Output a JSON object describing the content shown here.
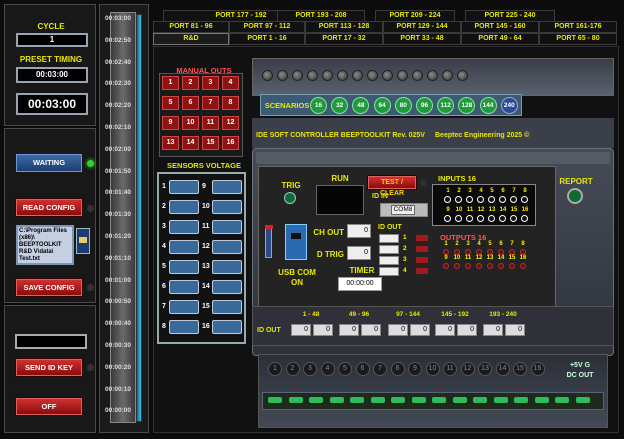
{
  "cycle": {
    "label": "CYCLE",
    "value": "1"
  },
  "preset": {
    "label": "PRESET TIMING",
    "value": "00:03:00",
    "display": "00:03:00"
  },
  "status": {
    "waiting": "WAITING"
  },
  "config": {
    "read": "READ CONFIG",
    "save": "SAVE CONFIG",
    "path": "C:\\Program Files (x86)\\ BEEPTOOLKIT R&D V\\data\\ Test.txt"
  },
  "idkey": {
    "send": "SEND ID KEY",
    "off": "OFF"
  },
  "timeline": [
    "00:03:00",
    "00:02:50",
    "00:02:40",
    "00:02:30",
    "00:02:20",
    "00:02:10",
    "00:02:00",
    "00:01:50",
    "00:01:40",
    "00:01:30",
    "00:01:20",
    "00:01:10",
    "00:01:00",
    "00:00:50",
    "00:00:40",
    "00:00:30",
    "00:00:20",
    "00:00:10",
    "00:00:00"
  ],
  "tabs": {
    "row1": [
      "PORT 177 - 192",
      "PORT 193 - 208",
      "PORT 209 - 224",
      "PORT 225 - 240"
    ],
    "row2": [
      "PORT 81 - 96",
      "PORT 97 - 112",
      "PORT 113 - 128",
      "PORT 129 - 144",
      "PORT 145 - 160",
      "PORT 161-176"
    ],
    "row3": [
      "R&D",
      "PORT 1 - 16",
      "PORT 17 - 32",
      "PORT 33 - 48",
      "PORT 49 - 64",
      "PORT 65 - 80"
    ]
  },
  "manual": {
    "label": "MANUAL OUTS TESTING",
    "buttons": [
      "1",
      "2",
      "3",
      "4",
      "5",
      "6",
      "7",
      "8",
      "9",
      "10",
      "11",
      "12",
      "13",
      "14",
      "15",
      "16"
    ]
  },
  "sensors": {
    "label": "SENSORS VOLTAGE",
    "left": [
      "1",
      "2",
      "3",
      "4",
      "5",
      "6",
      "7",
      "8"
    ],
    "right": [
      "9",
      "10",
      "11",
      "12",
      "13",
      "14",
      "15",
      "16"
    ]
  },
  "scenarios": {
    "label": "SCENARIOS",
    "values": [
      "16",
      "32",
      "48",
      "64",
      "80",
      "96",
      "112",
      "128",
      "144",
      "240"
    ]
  },
  "controller": {
    "title": "IDE SOFT CONTROLLER BEEPTOOLKIT Rev. 025V",
    "brand": "Beeptec Engineering 2025 ©",
    "trig": "TRIG",
    "run": "RUN",
    "test_clear": "TEST / CLEAR",
    "id_in": "ID IN",
    "com": "COM8",
    "inputs": "INPUTS 16",
    "report": "REPORT",
    "ch_out": "CH OUT",
    "ch_out_value": "0",
    "d_trig": "D TRIG",
    "d_trig_value": "0",
    "id_out": "ID OUT",
    "id_out_rows": [
      "1",
      "2",
      "3",
      "4"
    ],
    "outputs": "OUTPUTS 16",
    "usb": "USB COM",
    "on": "ON",
    "timer": "TIMER",
    "timer_value": "00:00:00",
    "input_numbers": [
      "1",
      "2",
      "3",
      "4",
      "5",
      "6",
      "7",
      "8",
      "9",
      "10",
      "11",
      "12",
      "13",
      "14",
      "15",
      "16"
    ],
    "output_numbers": [
      "1",
      "2",
      "3",
      "4",
      "5",
      "6",
      "7",
      "8",
      "9",
      "10",
      "11",
      "12",
      "13",
      "14",
      "15",
      "16"
    ],
    "power": "+5V G",
    "dc_out": "DC OUT"
  },
  "idout_bar": {
    "label": "ID OUT",
    "ranges": [
      "1 - 48",
      "49 - 96",
      "97 - 144",
      "145 - 192",
      "193 - 240"
    ],
    "values": [
      "0",
      "0",
      "0",
      "0",
      "0",
      "0",
      "0",
      "0",
      "0",
      "0"
    ]
  },
  "terminal_numbers": [
    "1",
    "2",
    "3",
    "4",
    "5",
    "6",
    "7",
    "8",
    "9",
    "10",
    "11",
    "12",
    "13",
    "14",
    "15",
    "16"
  ]
}
